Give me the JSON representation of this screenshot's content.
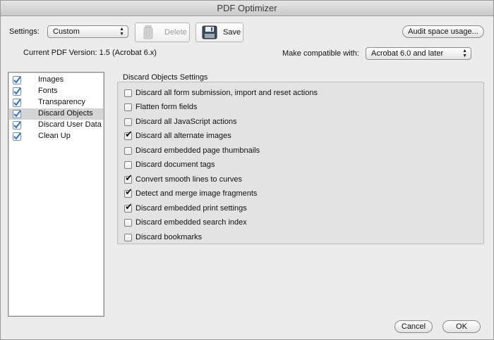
{
  "window": {
    "title": "PDF Optimizer"
  },
  "toolbar": {
    "settings_label": "Settings:",
    "settings_value": "Custom",
    "delete_label": "Delete",
    "save_label": "Save",
    "audit_label": "Audit space usage..."
  },
  "version": {
    "current_label": "Current PDF Version: 1.5 (Acrobat 6.x)",
    "compat_label": "Make compatible with:",
    "compat_value": "Acrobat 6.0 and later"
  },
  "sidebar": {
    "items": [
      {
        "label": "Images",
        "checked": true,
        "selected": false
      },
      {
        "label": "Fonts",
        "checked": true,
        "selected": false
      },
      {
        "label": "Transparency",
        "checked": true,
        "selected": false
      },
      {
        "label": "Discard Objects",
        "checked": true,
        "selected": true
      },
      {
        "label": "Discard User Data",
        "checked": true,
        "selected": false
      },
      {
        "label": "Clean Up",
        "checked": true,
        "selected": false
      }
    ]
  },
  "panel": {
    "title": "Discard Objects Settings",
    "options": [
      {
        "label": "Discard all form submission, import and reset actions",
        "checked": false
      },
      {
        "label": "Flatten form fields",
        "checked": false
      },
      {
        "label": "Discard all JavaScript actions",
        "checked": false
      },
      {
        "label": "Discard all alternate images",
        "checked": true
      },
      {
        "label": "Discard embedded page thumbnails",
        "checked": false
      },
      {
        "label": "Discard document tags",
        "checked": false
      },
      {
        "label": "Convert smooth lines to curves",
        "checked": true
      },
      {
        "label": "Detect and merge image fragments",
        "checked": true
      },
      {
        "label": "Discard embedded print settings",
        "checked": true
      },
      {
        "label": "Discard embedded search index",
        "checked": false
      },
      {
        "label": "Discard bookmarks",
        "checked": false
      }
    ]
  },
  "footer": {
    "cancel_label": "Cancel",
    "ok_label": "OK"
  },
  "icons": {
    "check": "checkmark-icon",
    "trash": "trash-icon",
    "floppy": "floppy-disk-icon",
    "popup_arrows": "up-down-arrows-icon"
  },
  "colors": {
    "check_blue": "#2f6fc9",
    "selected_row": "#d4d4d4"
  }
}
